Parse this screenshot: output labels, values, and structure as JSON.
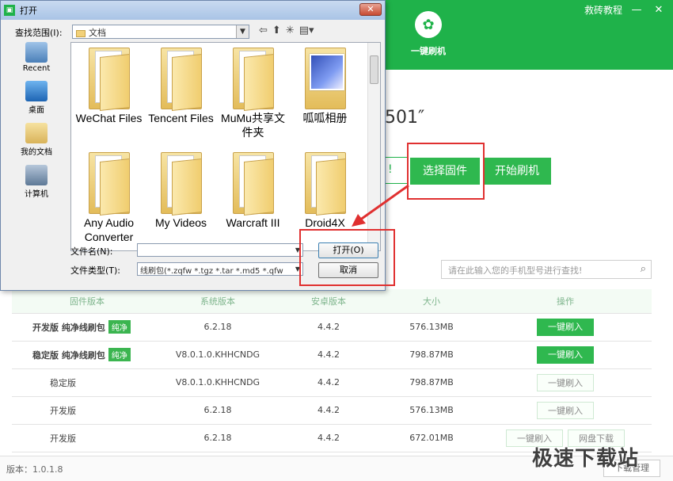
{
  "app": {
    "title_links": {
      "tutorial": "救砖教程"
    },
    "window_buttons": {
      "minimize": "—",
      "close": "✕"
    },
    "nav": {
      "flash_label": "一键刷机"
    },
    "model_fragment": "501″",
    "firmware_fragment": "! ",
    "buttons": {
      "choose_firmware": "选择固件",
      "start_flash": "开始刷机"
    },
    "search": {
      "placeholder": "请在此输入您的手机型号进行查找!"
    },
    "table": {
      "headers": [
        "固件版本",
        "系统版本",
        "安卓版本",
        "大小",
        "操作"
      ],
      "rows": [
        {
          "name": "开发版 纯净线刷包",
          "badge": "纯净",
          "system": "6.2.18",
          "android": "4.4.2",
          "size": "576.13MB",
          "action": "一键刷入",
          "action_style": "on",
          "extra": ""
        },
        {
          "name": "稳定版 纯净线刷包",
          "badge": "纯净",
          "system": "V8.0.1.0.KHHCNDG",
          "android": "4.4.2",
          "size": "798.87MB",
          "action": "一键刷入",
          "action_style": "on",
          "extra": ""
        },
        {
          "name": "稳定版",
          "badge": "",
          "system": "V8.0.1.0.KHHCNDG",
          "android": "4.4.2",
          "size": "798.87MB",
          "action": "一键刷入",
          "action_style": "off",
          "extra": ""
        },
        {
          "name": "开发版",
          "badge": "",
          "system": "6.2.18",
          "android": "4.4.2",
          "size": "576.13MB",
          "action": "一键刷入",
          "action_style": "off",
          "extra": ""
        },
        {
          "name": "开发版",
          "badge": "",
          "system": "6.2.18",
          "android": "4.4.2",
          "size": "672.01MB",
          "action": "一键刷入",
          "action_style": "off",
          "extra": "网盘下载"
        }
      ]
    },
    "footer": {
      "version": "版本：1.0.1.8",
      "manager": "下载管理"
    },
    "watermark": "极速下载站"
  },
  "dialog": {
    "title": "打开",
    "close": "✕",
    "look_in_label": "查找范围(I):",
    "look_in_value": "文档",
    "places": [
      "Recent",
      "桌面",
      "我的文档",
      "计算机"
    ],
    "files": [
      {
        "name": "WeChat Files",
        "type": "folder"
      },
      {
        "name": "Tencent Files",
        "type": "folder"
      },
      {
        "name": "MuMu共享文件夹",
        "type": "folder"
      },
      {
        "name": "呱呱相册",
        "type": "picture-folder"
      },
      {
        "name": "Any Audio Converter",
        "type": "folder"
      },
      {
        "name": "My Videos",
        "type": "folder"
      },
      {
        "name": "Warcraft III",
        "type": "folder"
      },
      {
        "name": "Droid4X",
        "type": "folder"
      }
    ],
    "filename_label": "文件名(N):",
    "filename_value": "",
    "filetype_label": "文件类型(T):",
    "filetype_value": "线刷包(*.zqfw *.tgz *.tar *.md5 *.qfw",
    "open_button": "打开(O)",
    "cancel_button": "取消"
  }
}
